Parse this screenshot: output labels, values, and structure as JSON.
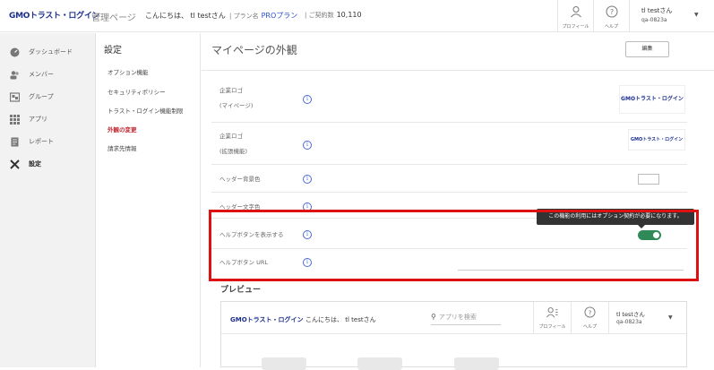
{
  "header": {
    "logo": "GMOトラスト・ログイン",
    "admin_page": "管理ページ",
    "greeting": "こんにちは、 tl testさん",
    "plan_label": "| プラン名",
    "plan_value": "PROプラン",
    "contract_label": "| ご契約数",
    "contract_value": "10,110",
    "profile_label": "プロフィール",
    "help_label": "ヘルプ",
    "user_name": "tl testさん",
    "user_id": "qa-0823a"
  },
  "sidebar": {
    "items": [
      {
        "label": "ダッシュボード",
        "icon": "dashboard-icon"
      },
      {
        "label": "メンバー",
        "icon": "members-icon"
      },
      {
        "label": "グループ",
        "icon": "group-icon"
      },
      {
        "label": "アプリ",
        "icon": "apps-icon"
      },
      {
        "label": "レポート",
        "icon": "report-icon"
      },
      {
        "label": "設定",
        "icon": "settings-icon"
      }
    ]
  },
  "submenu": {
    "title": "設定",
    "items": [
      {
        "label": "オプション機能"
      },
      {
        "label": "セキュリティポリシー"
      },
      {
        "label": "トラスト・ログイン機能制限"
      },
      {
        "label": "外観の変更"
      },
      {
        "label": "請求先情報"
      }
    ]
  },
  "main": {
    "title": "マイページの外観",
    "edit_label": "編集",
    "rows": {
      "logo_mypage_line1": "企業ロゴ",
      "logo_mypage_line2": "(マイページ)",
      "logo_ext_line1": "企業ロゴ",
      "logo_ext_line2": "(拡張機能)",
      "header_bg": "ヘッダー背景色",
      "header_text": "ヘッダー文字色",
      "help_button": "ヘルプボタンを表示する",
      "help_url": "ヘルプボタン URL"
    },
    "logo_text": "GMOトラスト・ログイン",
    "help_toggle_on": true,
    "tooltip": "この機能の利用にはオプション契約が必要になります。"
  },
  "preview": {
    "title": "プレビュー",
    "logo": "GMOトラスト・ログイン",
    "greeting": "こんにちは、 tl testさん",
    "search_placeholder": "アプリを検索",
    "profile_label": "プロフィール",
    "help_label": "ヘルプ",
    "user_name": "tl testさん",
    "user_id": "qa-0823a"
  },
  "colors": {
    "brand": "#1c2f8e",
    "accent_red": "#c0232c",
    "toggle_on": "#2f8a58",
    "highlight": "#dd1111"
  }
}
